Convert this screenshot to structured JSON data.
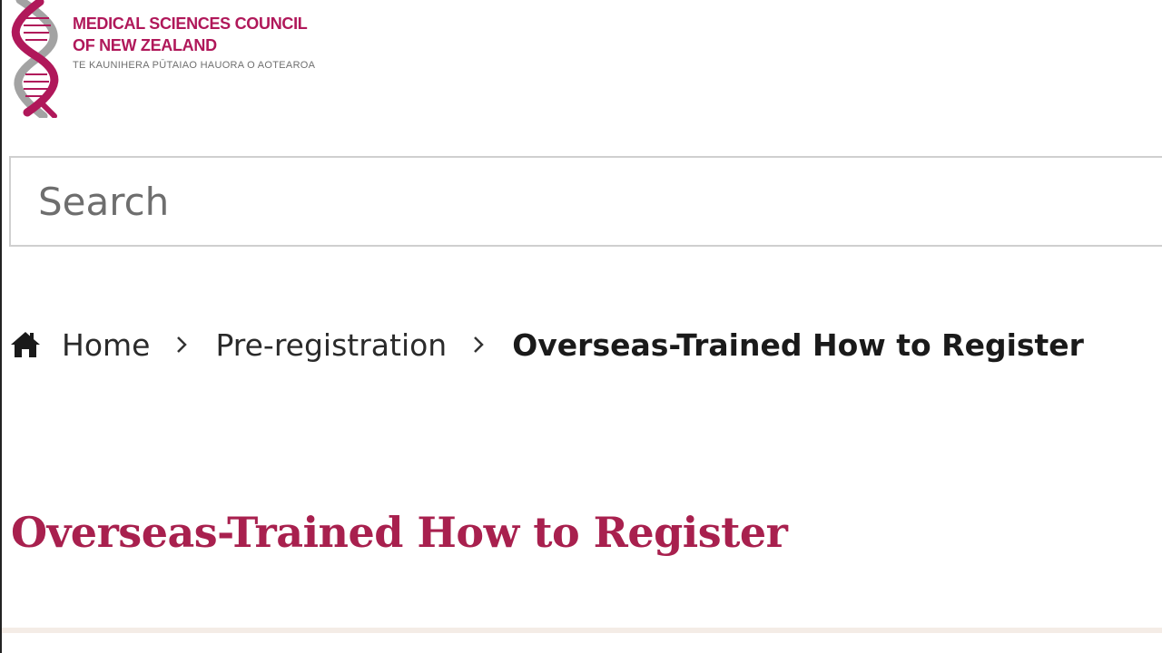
{
  "logo": {
    "line1": "MEDICAL SCIENCES COUNCIL",
    "line2": "OF NEW ZEALAND",
    "line3": "TE KAUNIHERA PŪTAIAO HAUORA O AOTEAROA",
    "colors": {
      "primary": "#b0185a",
      "secondary": "#9a9a9a"
    }
  },
  "search": {
    "placeholder": "Search",
    "value": ""
  },
  "breadcrumb": {
    "home_label": "Home",
    "items": [
      {
        "label": "Pre-registration"
      }
    ],
    "current": "Overseas-Trained How to Register",
    "separator_icon": "chevron-right-icon",
    "home_icon": "home-icon"
  },
  "page": {
    "title": "Overseas-Trained How to Register",
    "title_color": "#a8204e"
  }
}
